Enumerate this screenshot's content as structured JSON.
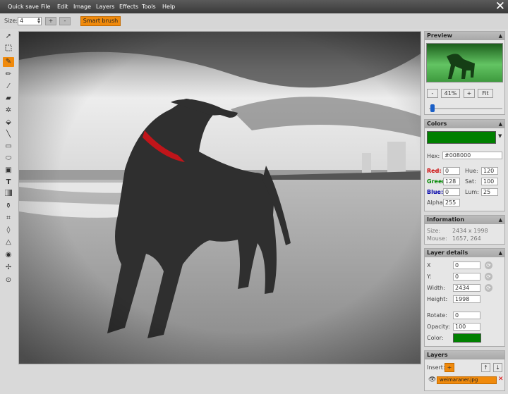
{
  "menu": {
    "items": [
      "Quick save",
      "File",
      "Edit",
      "Image",
      "Layers",
      "Effects",
      "Tools",
      "Help"
    ],
    "close": "✕"
  },
  "toolbar": {
    "size_label": "Size:",
    "size_value": "4",
    "plus": "+",
    "minus": "-",
    "smart_brush": "Smart brush"
  },
  "tools": [
    "select",
    "rect-select",
    "brush",
    "pencil",
    "picker",
    "erase",
    "magic-wand",
    "fill",
    "line",
    "rectangle",
    "ellipse",
    "image",
    "text",
    "gradient",
    "clone",
    "crop",
    "blur",
    "triangle",
    "sharpen",
    "desaturate",
    "animation"
  ],
  "preview": {
    "title": "Preview",
    "zoom_minus": "-",
    "zoom_value": "41%",
    "zoom_plus": "+",
    "fit": "Fit",
    "slider_level": 0.05
  },
  "colors": {
    "title": "Colors",
    "swatch": "#008000",
    "hex_label": "Hex:",
    "hex_value": "#008000",
    "red_label": "Red:",
    "red_value": "0",
    "green_label": "Green",
    "green_value": "128",
    "blue_label": "Blue:",
    "blue_value": "0",
    "hue_label": "Hue:",
    "hue_value": "120",
    "sat_label": "Sat:",
    "sat_value": "100",
    "lum_label": "Lum:",
    "lum_value": "25",
    "alpha_label": "Alpha:",
    "alpha_value": "255"
  },
  "information": {
    "title": "Information",
    "size_label": "Size:",
    "size_value": "2434 x 1998",
    "mouse_label": "Mouse:",
    "mouse_value": "1657, 264"
  },
  "layer_details": {
    "title": "Layer details",
    "x_label": "X",
    "x_value": "0",
    "y_label": "Y:",
    "y_value": "0",
    "width_label": "Width:",
    "width_value": "2434",
    "height_label": "Height:",
    "height_value": "1998",
    "rotate_label": "Rotate:",
    "rotate_value": "0",
    "opacity_label": "Opacity:",
    "opacity_value": "100",
    "color_label": "Color:",
    "color_swatch": "#008000"
  },
  "layers": {
    "title": "Layers",
    "insert_label": "Insert:",
    "insert_btn": "+",
    "up": "↑",
    "down": "↓",
    "layer_name": "weimaraner.jpg",
    "delete": "✕"
  },
  "colors_ui": {
    "accent": "#f08a0c",
    "menubar": "#444444"
  }
}
